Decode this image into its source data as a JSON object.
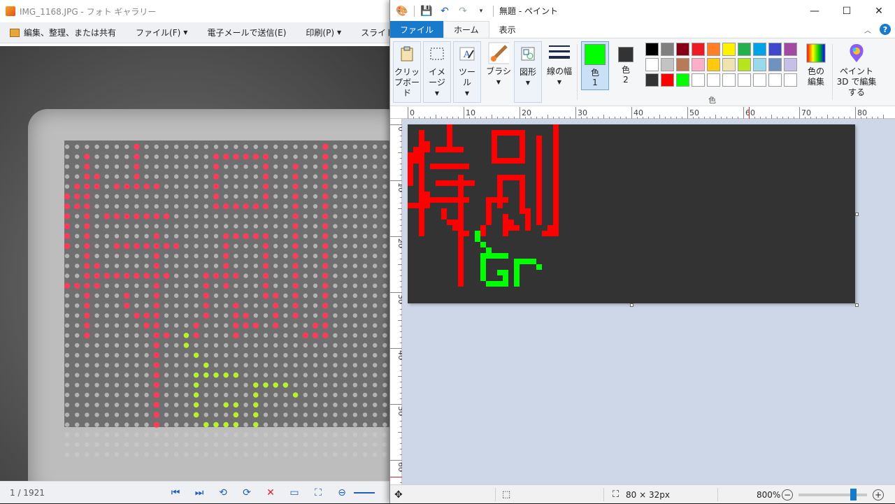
{
  "gallery": {
    "title": "IMG_1168.JPG - フォト ギャラリー",
    "menu": [
      {
        "label": "編集、整理、または共有",
        "dropdown": false
      },
      {
        "label": "ファイル(F)",
        "dropdown": true
      },
      {
        "label": "電子メールで送信(E)",
        "dropdown": false
      },
      {
        "label": "印刷(P)",
        "dropdown": true
      },
      {
        "label": "スライド ショー(S",
        "dropdown": false
      }
    ],
    "photo_counter": "1 / 1921",
    "led_colors": {
      "red": "#ff3b5c",
      "green": "#b8f22e",
      "off": "#c9c9c9"
    }
  },
  "paint": {
    "title": "無題 - ペイント",
    "tabs": {
      "file": "ファイル",
      "home": "ホーム",
      "view": "表示"
    },
    "ribbon": {
      "clipboard": "クリップボード",
      "image": "イメージ",
      "tools": "ツール",
      "brush": "ブラシ",
      "shapes": "図形",
      "line_width": "線の幅",
      "color1": "色",
      "color1_num": "1",
      "color2": "色",
      "color2_num": "2",
      "edit_colors": "色の編集",
      "paint3d": "ペイント 3D で編集する",
      "colors_group": "色"
    },
    "color1_value": "#00ff00",
    "color2_value": "#333333",
    "palette": [
      "#000000",
      "#7f7f7f",
      "#880015",
      "#ed1c24",
      "#ff7f27",
      "#fff200",
      "#22b14c",
      "#00a2e8",
      "#3f48cc",
      "#a349a4",
      "#ffffff",
      "#c3c3c3",
      "#b97a57",
      "#ffaec9",
      "#ffc90e",
      "#efe4b0",
      "#b5e61d",
      "#99d9ea",
      "#7092be",
      "#c8bfe7",
      "#333333",
      "#ff0000",
      "#00ff00",
      "#ffffff",
      "#ffffff",
      "#ffffff",
      "#ffffff",
      "#ffffff",
      "#ffffff",
      "#ffffff"
    ],
    "ruler_h": [
      "0",
      "10",
      "20",
      "30",
      "40",
      "50",
      "60",
      "70",
      "80"
    ],
    "ruler_v": [
      "0",
      "10",
      "20",
      "30",
      "40",
      "50",
      "60"
    ],
    "canvas_bg": "#333333",
    "image_size": "80 × 32px",
    "zoom": "800%",
    "zoom_level_percent": 800
  }
}
